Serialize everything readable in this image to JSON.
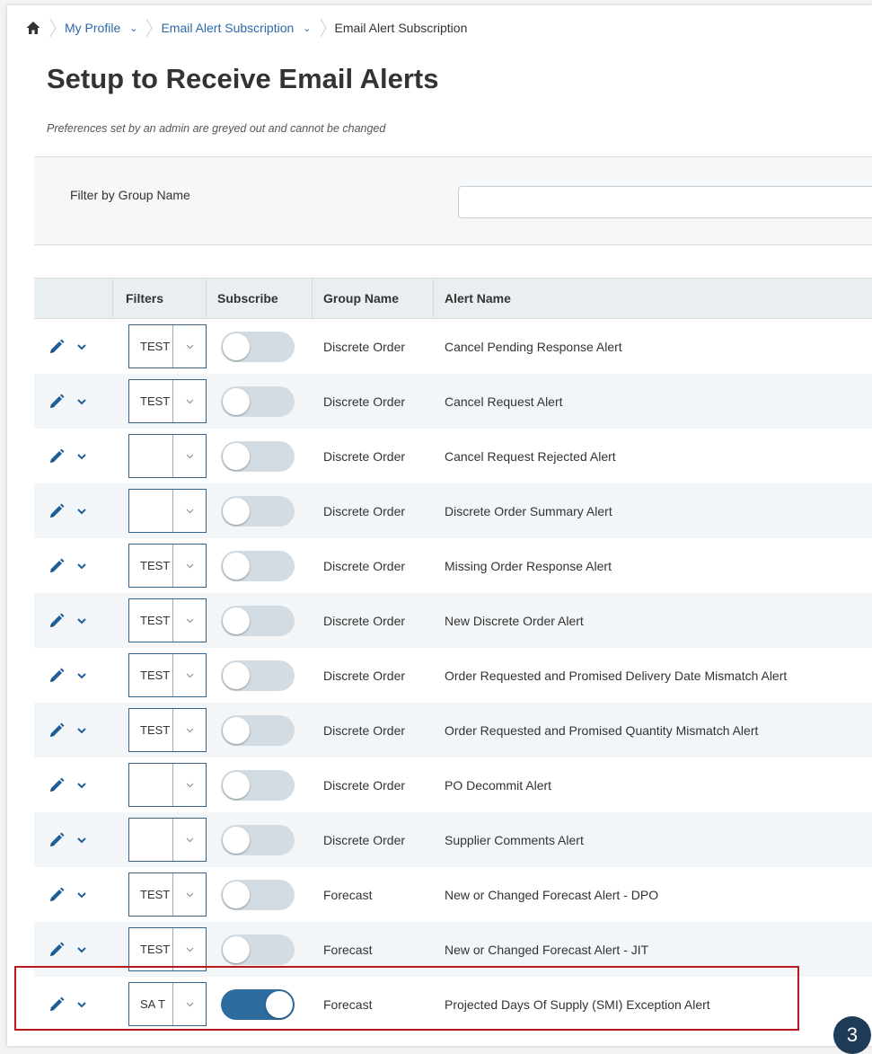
{
  "breadcrumb": {
    "home_icon": "home-icon",
    "items": [
      "My Profile",
      "Email Alert Subscription",
      "Email Alert Subscription"
    ]
  },
  "page": {
    "title": "Setup to Receive Email Alerts",
    "subtitle": "Preferences set by an admin are greyed out and cannot be changed"
  },
  "filter_panel": {
    "label": "Filter by Group Name",
    "value": "",
    "placeholder": ""
  },
  "table": {
    "columns": [
      "",
      "Filters",
      "Subscribe",
      "Group Name",
      "Alert Name"
    ],
    "rows": [
      {
        "filter": "TEST",
        "subscribed": false,
        "group": "Discrete Order",
        "alert": "Cancel Pending Response Alert"
      },
      {
        "filter": "TEST",
        "subscribed": false,
        "group": "Discrete Order",
        "alert": "Cancel Request Alert"
      },
      {
        "filter": "",
        "subscribed": false,
        "group": "Discrete Order",
        "alert": "Cancel Request Rejected Alert"
      },
      {
        "filter": "",
        "subscribed": false,
        "group": "Discrete Order",
        "alert": "Discrete Order Summary Alert"
      },
      {
        "filter": "TEST",
        "subscribed": false,
        "group": "Discrete Order",
        "alert": "Missing Order Response Alert"
      },
      {
        "filter": "TEST",
        "subscribed": false,
        "group": "Discrete Order",
        "alert": "New Discrete Order Alert"
      },
      {
        "filter": "TEST",
        "subscribed": false,
        "group": "Discrete Order",
        "alert": "Order Requested and Promised Delivery Date Mismatch Alert"
      },
      {
        "filter": "TEST",
        "subscribed": false,
        "group": "Discrete Order",
        "alert": "Order Requested and Promised Quantity Mismatch Alert"
      },
      {
        "filter": "",
        "subscribed": false,
        "group": "Discrete Order",
        "alert": "PO Decommit Alert"
      },
      {
        "filter": "",
        "subscribed": false,
        "group": "Discrete Order",
        "alert": "Supplier Comments Alert"
      },
      {
        "filter": "TEST",
        "subscribed": false,
        "group": "Forecast",
        "alert": "New or Changed Forecast Alert - DPO"
      },
      {
        "filter": "TEST",
        "subscribed": false,
        "group": "Forecast",
        "alert": "New or Changed Forecast Alert - JIT"
      },
      {
        "filter": "SA T",
        "subscribed": true,
        "group": "Forecast",
        "alert": "Projected Days Of Supply (SMI) Exception Alert"
      }
    ]
  },
  "annotation": {
    "step_number": "3",
    "highlight_color": "#b8171b",
    "badge_color": "#1f3b57"
  },
  "colors": {
    "link": "#2b6aa8",
    "toggle_on": "#2e6ca0",
    "toggle_off": "#d3dce2",
    "icon": "#1f5f99"
  }
}
